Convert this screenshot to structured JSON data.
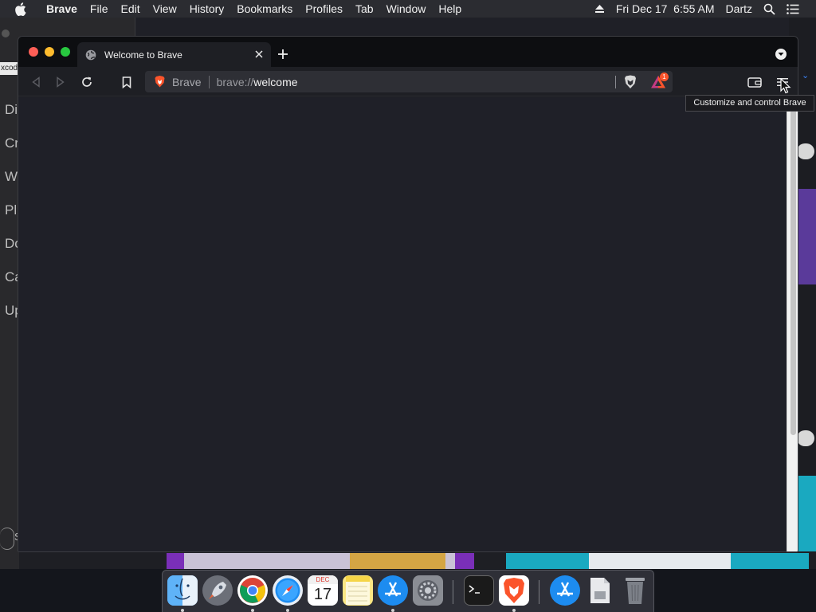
{
  "menubar": {
    "app_name": "Brave",
    "items": [
      "File",
      "Edit",
      "View",
      "History",
      "Bookmarks",
      "Profiles",
      "Tab",
      "Window",
      "Help"
    ],
    "datetime": "Fri Dec 17  6:55 AM",
    "user": "Dartz"
  },
  "background": {
    "left_panel_labels": [
      "Di",
      "Cr",
      "W",
      "Pl",
      "Do",
      "Ca",
      "Up"
    ],
    "left_tag": "xcod",
    "left_circle_text": "S"
  },
  "browser": {
    "tab": {
      "title": "Welcome to Brave"
    },
    "omnibox": {
      "site_label": "Brave",
      "url_prefix": "brave://",
      "url_host": "welcome"
    },
    "rewards_badge": "1",
    "tooltip": "Customize and control Brave",
    "theme": {
      "accent": "#fb542b",
      "chrome_bg": "#1e1f24",
      "content_bg": "#1f2028"
    }
  },
  "dock": {
    "calendar_month": "DEC",
    "calendar_day": "17",
    "apps": [
      "finder-icon",
      "launchpad-icon",
      "chrome-icon",
      "safari-icon",
      "calendar-icon",
      "notes-icon",
      "app-store-icon",
      "system-preferences-icon",
      "terminal-icon",
      "brave-icon",
      "app-store-folder-icon",
      "documents-folder-icon",
      "trash-icon"
    ]
  }
}
